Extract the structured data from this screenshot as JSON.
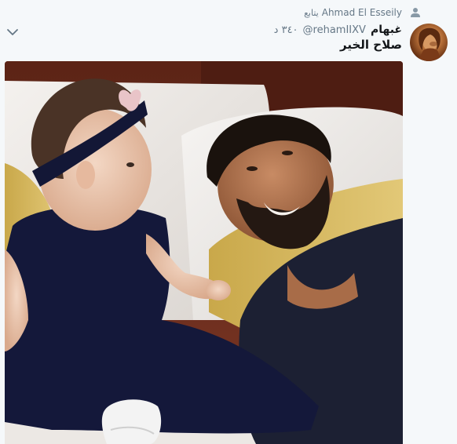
{
  "social_context": {
    "name": "Ahmad El Esseily",
    "action": "يتابع"
  },
  "header": {
    "fullname": "غبهام",
    "handle": "@rehamIIXV",
    "time": "٣٤٠ د"
  },
  "tweet": {
    "text": "صلاح الخير"
  },
  "icons": {
    "follow": "person-icon",
    "menu": "chevron-down-icon"
  },
  "colors": {
    "background": "#f5f8fa",
    "secondary_text": "#657786",
    "primary_text": "#14171a"
  }
}
